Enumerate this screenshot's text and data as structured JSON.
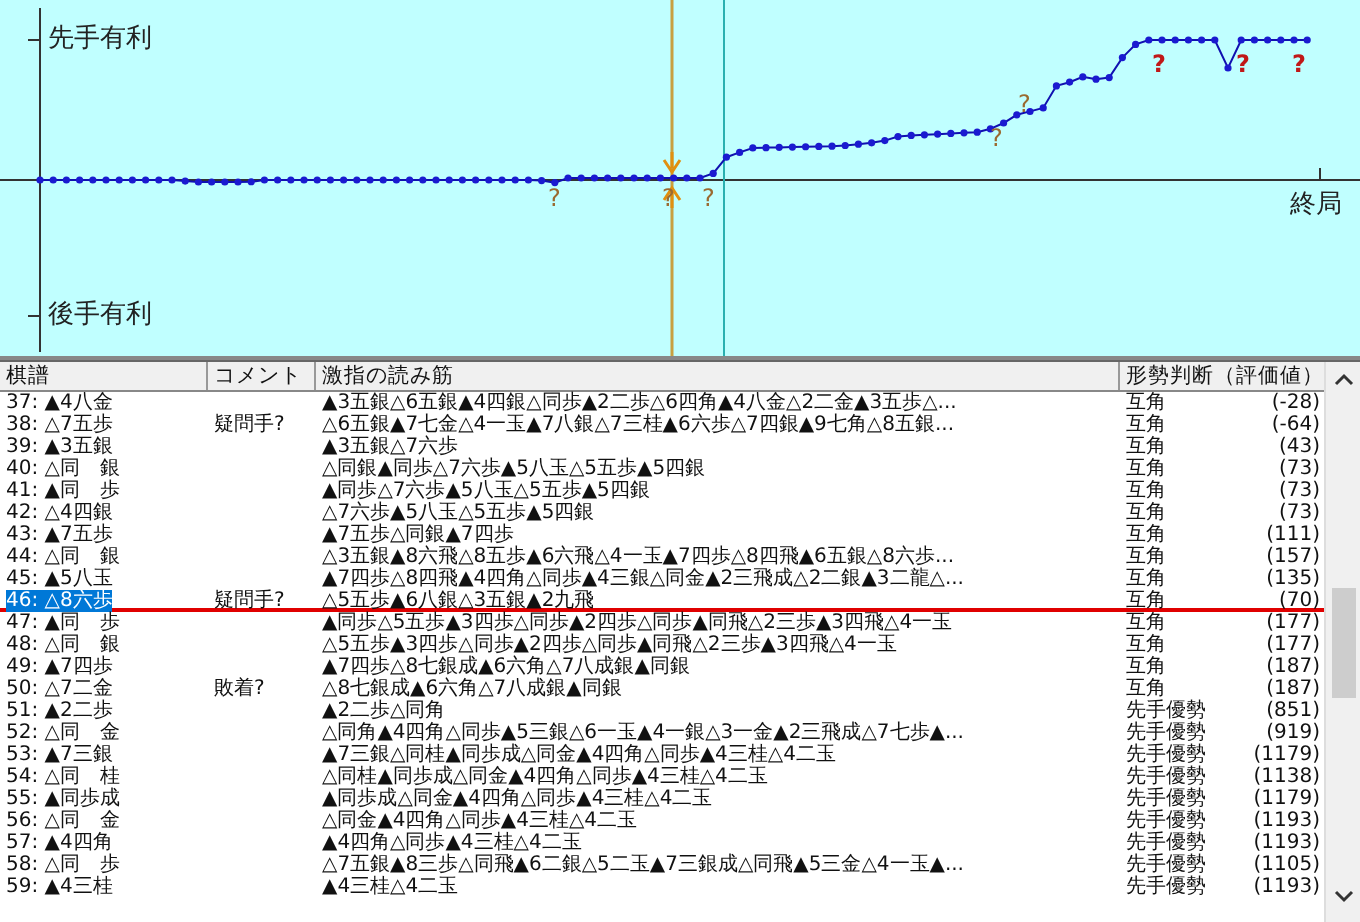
{
  "graph": {
    "top_label": "先手有利",
    "bottom_label": "後手有利",
    "end_label": "終局",
    "markers": [
      {
        "text": "?",
        "kind": "dubious"
      },
      {
        "text": "?",
        "kind": "dubious"
      },
      {
        "text": "?",
        "kind": "dubious"
      },
      {
        "text": "?",
        "kind": "dubious"
      },
      {
        "text": "?",
        "kind": "dubious"
      },
      {
        "text": "?",
        "kind": "blunder"
      },
      {
        "text": "?",
        "kind": "blunder"
      },
      {
        "text": "?",
        "kind": "blunder"
      }
    ]
  },
  "table": {
    "columns": [
      "棋譜",
      "コメント",
      "激指の読み筋",
      "形勢判断（評価値）"
    ],
    "rows": [
      {
        "move": "37: ▲4八金",
        "comment": "",
        "line": "▲3五銀△6五銀▲4四銀△同歩▲2二歩△6四角▲4八金△2二金▲3五歩△...",
        "judgment": "互角",
        "score": "(-28)",
        "selected": false
      },
      {
        "move": "38: △7五歩",
        "comment": "疑問手?",
        "line": "△6五銀▲7七金△4一玉▲7八銀△7三桂▲6六歩△7四銀▲9七角△8五銀...",
        "judgment": "互角",
        "score": "(-64)",
        "selected": false
      },
      {
        "move": "39: ▲3五銀",
        "comment": "",
        "line": "▲3五銀△7六歩",
        "judgment": "互角",
        "score": "(43)",
        "selected": false
      },
      {
        "move": "40: △同　銀",
        "comment": "",
        "line": "△同銀▲同歩△7六歩▲5八玉△5五歩▲5四銀",
        "judgment": "互角",
        "score": "(73)",
        "selected": false
      },
      {
        "move": "41: ▲同　歩",
        "comment": "",
        "line": "▲同歩△7六歩▲5八玉△5五歩▲5四銀",
        "judgment": "互角",
        "score": "(73)",
        "selected": false
      },
      {
        "move": "42: △4四銀",
        "comment": "",
        "line": "△7六歩▲5八玉△5五歩▲5四銀",
        "judgment": "互角",
        "score": "(73)",
        "selected": false
      },
      {
        "move": "43: ▲7五歩",
        "comment": "",
        "line": "▲7五歩△同銀▲7四歩",
        "judgment": "互角",
        "score": "(111)",
        "selected": false
      },
      {
        "move": "44: △同　銀",
        "comment": "",
        "line": "△3五銀▲8六飛△8五歩▲6六飛△4一玉▲7四歩△8四飛▲6五銀△8六歩...",
        "judgment": "互角",
        "score": "(157)",
        "selected": false
      },
      {
        "move": "45: ▲5八玉",
        "comment": "",
        "line": "▲7四歩△8四飛▲4四角△同歩▲4三銀△同金▲2三飛成△2二銀▲3二龍△...",
        "judgment": "互角",
        "score": "(135)",
        "selected": false
      },
      {
        "move": "46: △8六歩",
        "comment": "疑問手?",
        "line": "△5五歩▲6八銀△3五銀▲2九飛",
        "judgment": "互角",
        "score": "(70)",
        "selected": true
      },
      {
        "move": "47: ▲同　歩",
        "comment": "",
        "line": "▲同歩△5五歩▲3四歩△同歩▲2四歩△同歩▲同飛△2三歩▲3四飛△4一玉",
        "judgment": "互角",
        "score": "(177)",
        "selected": false
      },
      {
        "move": "48: △同　銀",
        "comment": "",
        "line": "△5五歩▲3四歩△同歩▲2四歩△同歩▲同飛△2三歩▲3四飛△4一玉",
        "judgment": "互角",
        "score": "(177)",
        "selected": false
      },
      {
        "move": "49: ▲7四歩",
        "comment": "",
        "line": "▲7四歩△8七銀成▲6六角△7八成銀▲同銀",
        "judgment": "互角",
        "score": "(187)",
        "selected": false
      },
      {
        "move": "50: △7二金",
        "comment": "敗着?",
        "line": "△8七銀成▲6六角△7八成銀▲同銀",
        "judgment": "互角",
        "score": "(187)",
        "selected": false
      },
      {
        "move": "51: ▲2二歩",
        "comment": "",
        "line": "▲2二歩△同角",
        "judgment": "先手優勢",
        "score": "(851)",
        "selected": false
      },
      {
        "move": "52: △同　金",
        "comment": "",
        "line": "△同角▲4四角△同歩▲5三銀△6一玉▲4一銀△3一金▲2三飛成△7七歩▲...",
        "judgment": "先手優勢",
        "score": "(919)",
        "selected": false
      },
      {
        "move": "53: ▲7三銀",
        "comment": "",
        "line": "▲7三銀△同桂▲同歩成△同金▲4四角△同歩▲4三桂△4二玉",
        "judgment": "先手優勢",
        "score": "(1179)",
        "selected": false
      },
      {
        "move": "54: △同　桂",
        "comment": "",
        "line": "△同桂▲同歩成△同金▲4四角△同歩▲4三桂△4二玉",
        "judgment": "先手優勢",
        "score": "(1138)",
        "selected": false
      },
      {
        "move": "55: ▲同歩成",
        "comment": "",
        "line": "▲同歩成△同金▲4四角△同歩▲4三桂△4二玉",
        "judgment": "先手優勢",
        "score": "(1179)",
        "selected": false
      },
      {
        "move": "56: △同　金",
        "comment": "",
        "line": "△同金▲4四角△同歩▲4三桂△4二玉",
        "judgment": "先手優勢",
        "score": "(1193)",
        "selected": false
      },
      {
        "move": "57: ▲4四角",
        "comment": "",
        "line": "▲4四角△同歩▲4三桂△4二玉",
        "judgment": "先手優勢",
        "score": "(1193)",
        "selected": false
      },
      {
        "move": "58: △同　歩",
        "comment": "",
        "line": "△7五銀▲8三歩△同飛▲6二銀△5二玉▲7三銀成△同飛▲5三金△4一玉▲...",
        "judgment": "先手優勢",
        "score": "(1105)",
        "selected": false
      },
      {
        "move": "59: ▲4三桂",
        "comment": "",
        "line": "▲4三桂△4二玉",
        "judgment": "先手優勢",
        "score": "(1193)",
        "selected": false
      }
    ]
  }
}
